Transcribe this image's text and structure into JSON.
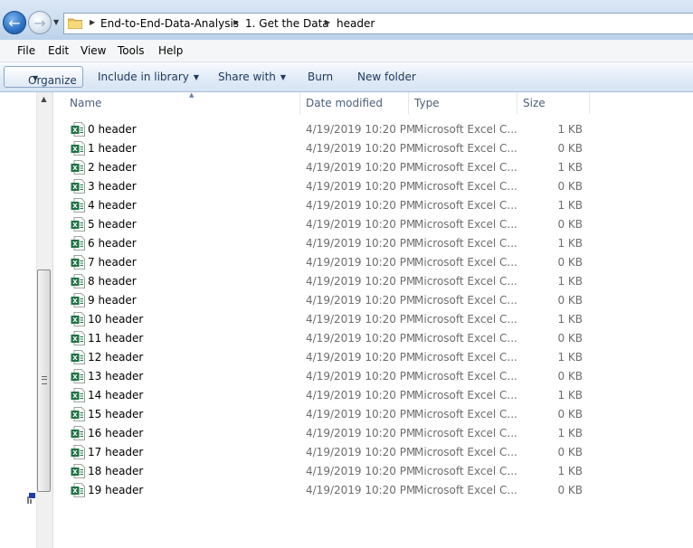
{
  "address": {
    "crumbs": [
      "End-to-End-Data-Analysis",
      "1. Get the Data",
      "header"
    ]
  },
  "menu": [
    "File",
    "Edit",
    "View",
    "Tools",
    "Help"
  ],
  "commands": {
    "organize": "Organize",
    "include": "Include in library",
    "share": "Share with",
    "burn": "Burn",
    "new_folder": "New folder"
  },
  "columns": {
    "name": "Name",
    "date": "Date modified",
    "type": "Type",
    "size": "Size"
  },
  "files": [
    {
      "name": "0 header",
      "date": "4/19/2019 10:20 PM",
      "type": "Microsoft Excel C...",
      "size": "1 KB"
    },
    {
      "name": "1 header",
      "date": "4/19/2019 10:20 PM",
      "type": "Microsoft Excel C...",
      "size": "0 KB"
    },
    {
      "name": "2 header",
      "date": "4/19/2019 10:20 PM",
      "type": "Microsoft Excel C...",
      "size": "1 KB"
    },
    {
      "name": "3 header",
      "date": "4/19/2019 10:20 PM",
      "type": "Microsoft Excel C...",
      "size": "0 KB"
    },
    {
      "name": "4 header",
      "date": "4/19/2019 10:20 PM",
      "type": "Microsoft Excel C...",
      "size": "1 KB"
    },
    {
      "name": "5 header",
      "date": "4/19/2019 10:20 PM",
      "type": "Microsoft Excel C...",
      "size": "0 KB"
    },
    {
      "name": "6 header",
      "date": "4/19/2019 10:20 PM",
      "type": "Microsoft Excel C...",
      "size": "1 KB"
    },
    {
      "name": "7 header",
      "date": "4/19/2019 10:20 PM",
      "type": "Microsoft Excel C...",
      "size": "0 KB"
    },
    {
      "name": "8 header",
      "date": "4/19/2019 10:20 PM",
      "type": "Microsoft Excel C...",
      "size": "1 KB"
    },
    {
      "name": "9 header",
      "date": "4/19/2019 10:20 PM",
      "type": "Microsoft Excel C...",
      "size": "0 KB"
    },
    {
      "name": "10 header",
      "date": "4/19/2019 10:20 PM",
      "type": "Microsoft Excel C...",
      "size": "1 KB"
    },
    {
      "name": "11 header",
      "date": "4/19/2019 10:20 PM",
      "type": "Microsoft Excel C...",
      "size": "0 KB"
    },
    {
      "name": "12 header",
      "date": "4/19/2019 10:20 PM",
      "type": "Microsoft Excel C...",
      "size": "1 KB"
    },
    {
      "name": "13 header",
      "date": "4/19/2019 10:20 PM",
      "type": "Microsoft Excel C...",
      "size": "0 KB"
    },
    {
      "name": "14 header",
      "date": "4/19/2019 10:20 PM",
      "type": "Microsoft Excel C...",
      "size": "1 KB"
    },
    {
      "name": "15 header",
      "date": "4/19/2019 10:20 PM",
      "type": "Microsoft Excel C...",
      "size": "0 KB"
    },
    {
      "name": "16 header",
      "date": "4/19/2019 10:20 PM",
      "type": "Microsoft Excel C...",
      "size": "1 KB"
    },
    {
      "name": "17 header",
      "date": "4/19/2019 10:20 PM",
      "type": "Microsoft Excel C...",
      "size": "0 KB"
    },
    {
      "name": "18 header",
      "date": "4/19/2019 10:20 PM",
      "type": "Microsoft Excel C...",
      "size": "1 KB"
    },
    {
      "name": "19 header",
      "date": "4/19/2019 10:20 PM",
      "type": "Microsoft Excel C...",
      "size": "0 KB"
    }
  ],
  "icons": {
    "file": "excel-csv-icon",
    "folder": "folder-icon",
    "back": "back-arrow-icon",
    "forward": "forward-arrow-icon"
  },
  "colors": {
    "excel_green": "#1f7244",
    "header_text": "#4c607a",
    "secondary_text": "#6d6d6d"
  }
}
